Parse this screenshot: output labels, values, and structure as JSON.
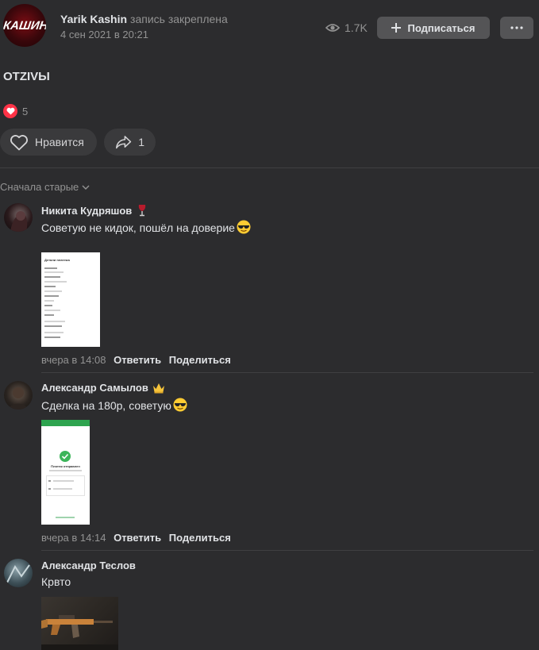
{
  "post": {
    "author": "Yarik Kashin",
    "pinned_label": "запись закреплена",
    "date": "4 сен 2021 в 20:21",
    "views": "1.7K",
    "subscribe_label": "Подписаться",
    "logo_text": "КАШИН",
    "text": "OTZIVЫ",
    "reactions_count": "5",
    "like_label": "Нравится",
    "share_count": "1",
    "accent_color": "#ff3347"
  },
  "sort": {
    "label": "Сначала старые"
  },
  "comments": [
    {
      "name": "Никита Кудряшов",
      "badge_icon": "wine-glass-icon",
      "text": "Советую не кидок, пошёл на доверие",
      "emoji_icon": "sunglasses-emoji-icon",
      "attachment_text": "Детали платежа",
      "time": "вчера в 14:08",
      "reply_label": "Ответить",
      "share_label": "Поделиться"
    },
    {
      "name": "Александр Самылов",
      "badge_icon": "crown-icon",
      "text": "Сделка на 180р, советую",
      "emoji_icon": "sunglasses-emoji-icon",
      "attachment_text": "Платеж отправлен",
      "time": "вчера в 14:14",
      "reply_label": "Ответить",
      "share_label": "Поделиться"
    },
    {
      "name": "Александр Теслов",
      "text": "Крвто"
    }
  ]
}
